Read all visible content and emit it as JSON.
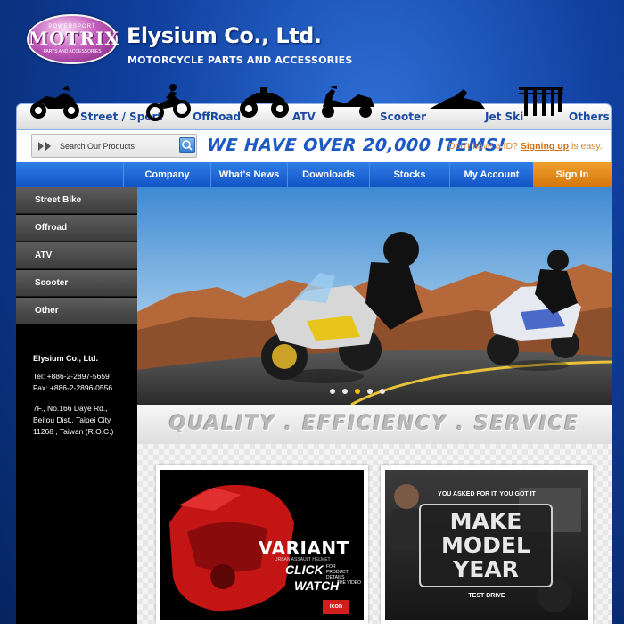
{
  "brand": {
    "logo_top": "POWERSPORT",
    "logo_main": "MOTRIX",
    "logo_bottom": "PARTS AND ACCESSORIES",
    "company_name": "Elysium Co., Ltd.",
    "tagline": "MOTORCYCLE PARTS AND ACCESSORIES"
  },
  "categories": [
    {
      "label": "Street / Sport",
      "icon": "street-bike-icon"
    },
    {
      "label": "OffRoad",
      "icon": "dirt-bike-icon"
    },
    {
      "label": "ATV",
      "icon": "atv-icon"
    },
    {
      "label": "Scooter",
      "icon": "scooter-icon"
    },
    {
      "label": "Jet Ski",
      "icon": "jet-ski-icon"
    },
    {
      "label": "Others",
      "icon": "parts-icon"
    }
  ],
  "search": {
    "placeholder": "Search Our Products",
    "banner": "WE HAVE OVER 20,000 ITEMS!",
    "signup_prefix": "Don't have a ID?",
    "signup_link": "Signing up",
    "signup_suffix": "is easy."
  },
  "nav": {
    "items": [
      "Company",
      "What's News",
      "Downloads",
      "Stocks",
      "My Account"
    ],
    "signin": "Sign In"
  },
  "sidebar": {
    "items": [
      "Street Bike",
      "Offroad",
      "ATV",
      "Scooter",
      "Other"
    ],
    "contact": {
      "name": "Elysium Co., Ltd.",
      "tel": "Tel: +886-2-2897-5659",
      "fax": "Fax: +886-2-2896-0556",
      "addr1": "7F., No.166 Daye Rd.,",
      "addr2": "Beitou Dist., Taipei City",
      "addr3": "11268 , Taiwan (R.O.C.)"
    }
  },
  "slider": {
    "dots": 5,
    "active_dot": 3
  },
  "quality_banner": "QUALITY . EFFICIENCY . SERVICE",
  "promos": [
    {
      "title": "VARIANT",
      "subtitle": "URBAN ASSAULT HELMET",
      "line1": "CLICK",
      "line1b": "FOR PRODUCT DETAILS",
      "line2": "WATCH",
      "line2b": "THE VIDEO",
      "brand": "icon"
    },
    {
      "top": "YOU ASKED FOR IT, YOU GOT IT",
      "l1": "MAKE",
      "l2": "MODEL",
      "l3": "YEAR",
      "bottom": "TEST DRIVE"
    }
  ],
  "colors": {
    "accent_blue": "#1353c6",
    "signin_orange": "#d4760a",
    "link_orange": "#d17018",
    "active_dot": "#f2c10c"
  }
}
